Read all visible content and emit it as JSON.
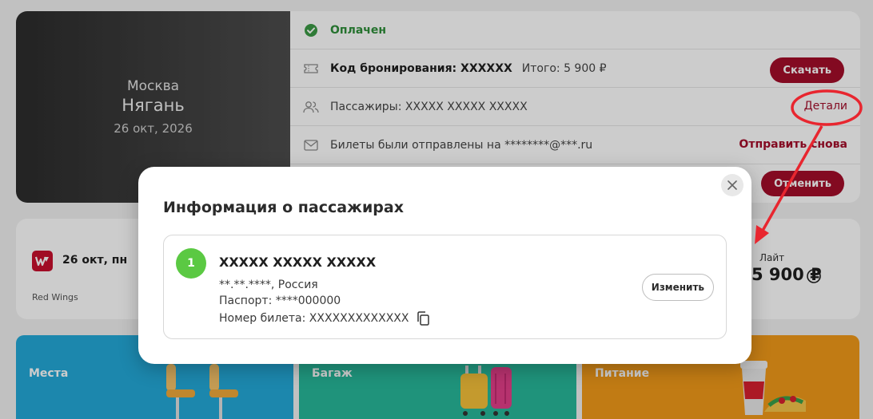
{
  "route": {
    "from": "Москва",
    "to": "Нягань",
    "date": "26 окт, 2026"
  },
  "booking": {
    "status": "Оплачен",
    "code_label": "Код бронирования: XXXXXX",
    "total": "Итого:  5 900 ₽",
    "download_label": "Скачать",
    "passengers_text": "Пассажиры: XXXXX XXXXX XXXXX",
    "details_label": "Детали",
    "tickets_sent_text": "Билеты были отправлены на ********@***.ru",
    "resend_label": "Отправить снова",
    "cancel_label": "Отменить"
  },
  "flight": {
    "date": "26 окт, пн",
    "airline": "Red Wings",
    "fare": "Лайт",
    "price": "5 900 ₽"
  },
  "services": {
    "seats": "Места",
    "baggage": "Багаж",
    "meals": "Питание"
  },
  "modal": {
    "title": "Информация о пассажирах",
    "passenger": {
      "number": "1",
      "name": "XXXXX XXXXX XXXXX",
      "dob_country": "**.**.****, Россия",
      "passport": "Паспорт: ****000000",
      "ticket": "Номер билета: XXXXXXXXXXXXX",
      "edit_label": "Изменить"
    }
  },
  "colors": {
    "accent_red": "#a40d2a",
    "success_green": "#2f8f3a",
    "badge_green": "#5bc943",
    "annotation_red": "#e8262f"
  },
  "icons": {
    "status": "check-circle-icon",
    "code": "ticket-icon",
    "passengers": "users-icon",
    "email": "mail-icon",
    "close": "close-icon",
    "copy": "copy-icon",
    "info": "info-icon"
  }
}
